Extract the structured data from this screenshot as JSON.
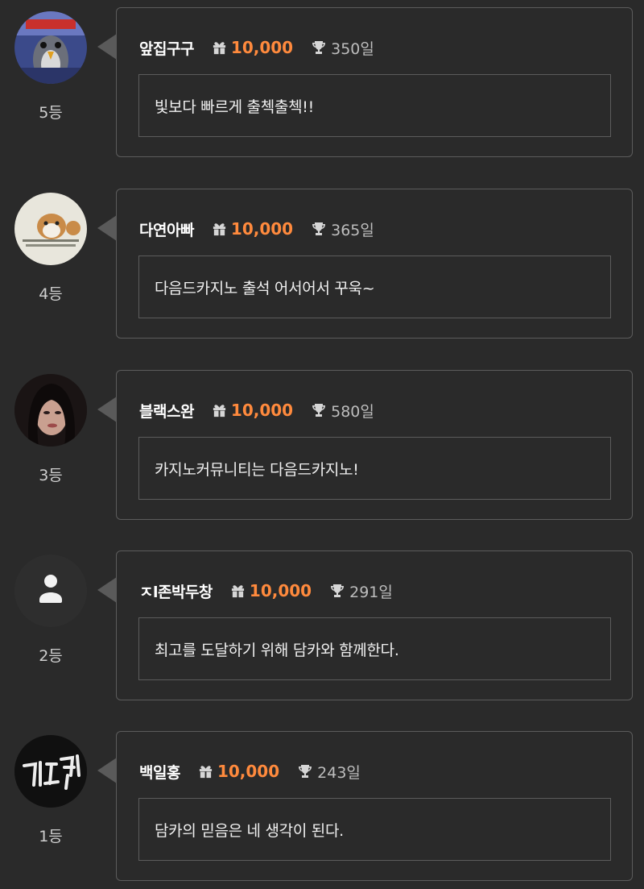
{
  "colors": {
    "background": "#2a2a2a",
    "border": "#5c5c5c",
    "points": "#ff8a3d",
    "nickname": "#ffffff",
    "muted": "#bdbdbd"
  },
  "icons": {
    "points": "gift-icon",
    "days": "trophy-icon",
    "default_avatar": "user-icon"
  },
  "entries": [
    {
      "rank": "5등",
      "nickname": "앞집구구",
      "points": "10,000",
      "days": "350일",
      "message": "빛보다 빠르게 출첵출첵!!",
      "avatar": "penguin-character"
    },
    {
      "rank": "4등",
      "nickname": "다연아빠",
      "points": "10,000",
      "days": "365일",
      "message": "다음드카지노 출석 어서어서 꾸욱~",
      "avatar": "hamster-character"
    },
    {
      "rank": "3등",
      "nickname": "블랙스완",
      "points": "10,000",
      "days": "580일",
      "message": "카지노커뮤니티는 다음드카지노!",
      "avatar": "portrait-photo"
    },
    {
      "rank": "2등",
      "nickname": "ㅈl존박두창",
      "points": "10,000",
      "days": "291일",
      "message": "최고를 도달하기 위해 담카와 함께한다.",
      "avatar": "default-user"
    },
    {
      "rank": "1등",
      "nickname": "백일홍",
      "points": "10,000",
      "days": "243일",
      "message": "담카의 믿음은 네 생각이 된다.",
      "avatar": "neon-text-image"
    }
  ]
}
